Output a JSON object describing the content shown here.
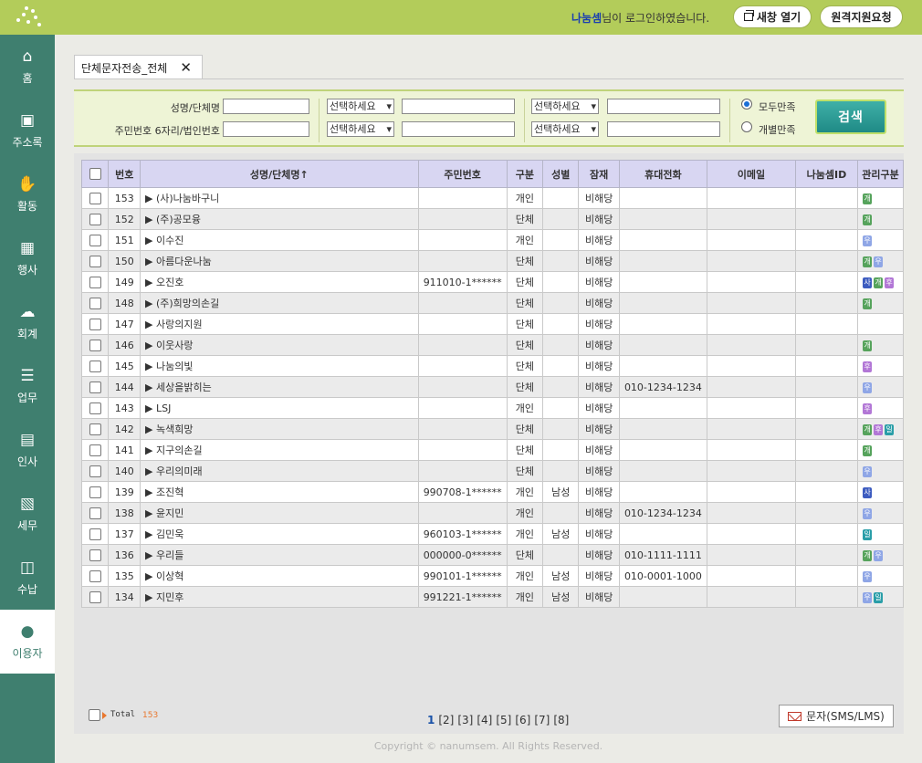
{
  "header": {
    "user_name": "나눔셈",
    "login_suffix": "님이 로그인하였습니다.",
    "new_window_label": "새창 열기",
    "remote_support_label": "원격지원요청"
  },
  "sidebar": {
    "items": [
      {
        "label": "홈",
        "icon": "home-icon",
        "glyph": "⌂"
      },
      {
        "label": "주소록",
        "icon": "addressbook-icon",
        "glyph": "▣"
      },
      {
        "label": "활동",
        "icon": "activity-icon",
        "glyph": "✋"
      },
      {
        "label": "행사",
        "icon": "calendar-icon",
        "glyph": "▦"
      },
      {
        "label": "회계",
        "icon": "accounting-icon",
        "glyph": "☁"
      },
      {
        "label": "업무",
        "icon": "task-list-icon",
        "glyph": "☰"
      },
      {
        "label": "인사",
        "icon": "id-card-icon",
        "glyph": "▤"
      },
      {
        "label": "세무",
        "icon": "tax-icon",
        "glyph": "▧"
      },
      {
        "label": "수납",
        "icon": "sms-payment-icon",
        "glyph": "◫"
      },
      {
        "label": "이용자",
        "icon": "user-icon",
        "glyph": "●"
      }
    ],
    "active_index": 9
  },
  "tab": {
    "label": "단체문자전송_전체",
    "close": "✕"
  },
  "search": {
    "name_label": "성명/단체명",
    "id_label": "주민번호 6자리/법인번호",
    "select_placeholder": "선택하세요",
    "radio_all": "모두만족",
    "radio_each": "개별만족",
    "search_button": "검색"
  },
  "table": {
    "headers": [
      "번호",
      "성명/단체명↑",
      "주민번호",
      "구분",
      "성별",
      "잠재",
      "휴대전화",
      "이메일",
      "나눔셈ID",
      "관리구분"
    ],
    "rows": [
      {
        "no": "153",
        "name": "(사)나눔바구니",
        "jumin": "",
        "type": "개인",
        "gender": "",
        "potential": "비해당",
        "phone": "",
        "email": "",
        "uid": "",
        "badges": [
          "green"
        ]
      },
      {
        "no": "152",
        "name": "(주)공모융",
        "jumin": "",
        "type": "단체",
        "gender": "",
        "potential": "비해당",
        "phone": "",
        "email": "",
        "uid": "",
        "badges": [
          "green"
        ]
      },
      {
        "no": "151",
        "name": "이수진",
        "jumin": "",
        "type": "개인",
        "gender": "",
        "potential": "비해당",
        "phone": "",
        "email": "",
        "uid": "",
        "badges": [
          "lblue"
        ]
      },
      {
        "no": "150",
        "name": "아름다운나눔",
        "jumin": "",
        "type": "단체",
        "gender": "",
        "potential": "비해당",
        "phone": "",
        "email": "",
        "uid": "",
        "badges": [
          "green",
          "lblue"
        ]
      },
      {
        "no": "149",
        "name": "오진호",
        "jumin": "911010-1******",
        "type": "단체",
        "gender": "",
        "potential": "비해당",
        "phone": "",
        "email": "",
        "uid": "",
        "badges": [
          "navy",
          "green",
          "purple"
        ]
      },
      {
        "no": "148",
        "name": "(주)희망의손길",
        "jumin": "",
        "type": "단체",
        "gender": "",
        "potential": "비해당",
        "phone": "",
        "email": "",
        "uid": "",
        "badges": [
          "green"
        ]
      },
      {
        "no": "147",
        "name": "사랑의지원",
        "jumin": "",
        "type": "단체",
        "gender": "",
        "potential": "비해당",
        "phone": "",
        "email": "",
        "uid": "",
        "badges": []
      },
      {
        "no": "146",
        "name": "이웃사랑",
        "jumin": "",
        "type": "단체",
        "gender": "",
        "potential": "비해당",
        "phone": "",
        "email": "",
        "uid": "",
        "badges": [
          "green"
        ]
      },
      {
        "no": "145",
        "name": "나눔의빛",
        "jumin": "",
        "type": "단체",
        "gender": "",
        "potential": "비해당",
        "phone": "",
        "email": "",
        "uid": "",
        "badges": [
          "purple"
        ]
      },
      {
        "no": "144",
        "name": "세상을밝히는",
        "jumin": "",
        "type": "단체",
        "gender": "",
        "potential": "비해당",
        "phone": "010-1234-1234",
        "email": "",
        "uid": "",
        "badges": [
          "lblue"
        ]
      },
      {
        "no": "143",
        "name": "LSJ",
        "jumin": "",
        "type": "개인",
        "gender": "",
        "potential": "비해당",
        "phone": "",
        "email": "",
        "uid": "",
        "badges": [
          "purple"
        ]
      },
      {
        "no": "142",
        "name": "녹색희망",
        "jumin": "",
        "type": "단체",
        "gender": "",
        "potential": "비해당",
        "phone": "",
        "email": "",
        "uid": "",
        "badges": [
          "green",
          "purple",
          "teal"
        ]
      },
      {
        "no": "141",
        "name": "지구의손길",
        "jumin": "",
        "type": "단체",
        "gender": "",
        "potential": "비해당",
        "phone": "",
        "email": "",
        "uid": "",
        "badges": [
          "green"
        ]
      },
      {
        "no": "140",
        "name": "우리의미래",
        "jumin": "",
        "type": "단체",
        "gender": "",
        "potential": "비해당",
        "phone": "",
        "email": "",
        "uid": "",
        "badges": [
          "lblue"
        ]
      },
      {
        "no": "139",
        "name": "조진혁",
        "jumin": "990708-1******",
        "type": "개인",
        "gender": "남성",
        "potential": "비해당",
        "phone": "",
        "email": "",
        "uid": "",
        "badges": [
          "navy"
        ]
      },
      {
        "no": "138",
        "name": "윤지민",
        "jumin": "",
        "type": "개인",
        "gender": "",
        "potential": "비해당",
        "phone": "010-1234-1234",
        "email": "",
        "uid": "",
        "badges": [
          "lblue"
        ]
      },
      {
        "no": "137",
        "name": "김민욱",
        "jumin": "960103-1******",
        "type": "개인",
        "gender": "남성",
        "potential": "비해당",
        "phone": "",
        "email": "",
        "uid": "",
        "badges": [
          "teal"
        ]
      },
      {
        "no": "136",
        "name": "우리들",
        "jumin": "000000-0******",
        "type": "단체",
        "gender": "",
        "potential": "비해당",
        "phone": "010-1111-1111",
        "email": "",
        "uid": "",
        "badges": [
          "green",
          "lblue"
        ]
      },
      {
        "no": "135",
        "name": "이상혁",
        "jumin": "990101-1******",
        "type": "개인",
        "gender": "남성",
        "potential": "비해당",
        "phone": "010-0001-1000",
        "email": "",
        "uid": "",
        "badges": [
          "lblue"
        ]
      },
      {
        "no": "134",
        "name": "지민후",
        "jumin": "991221-1******",
        "type": "개인",
        "gender": "남성",
        "potential": "비해당",
        "phone": "",
        "email": "",
        "uid": "",
        "badges": [
          "lblue",
          "teal"
        ]
      }
    ]
  },
  "footer": {
    "total_label": "Total",
    "total_value": "153",
    "pages": [
      "1",
      "[2]",
      "[3]",
      "[4]",
      "[5]",
      "[6]",
      "[7]",
      "[8]"
    ],
    "current_page": "1",
    "sms_button": "문자(SMS/LMS)",
    "copyright": "Copyright © nanumsem. All Rights Reserved."
  }
}
